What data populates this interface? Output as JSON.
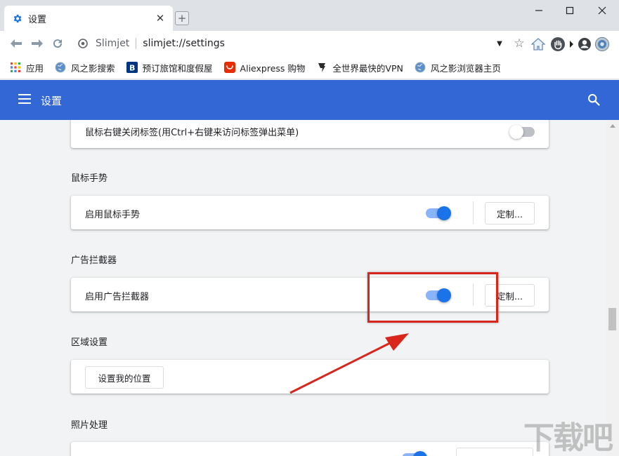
{
  "window": {
    "tab_title": "设置",
    "tab_icon": "gear-icon",
    "controls": [
      "minimize-icon",
      "maximize-icon",
      "close-icon"
    ]
  },
  "toolbar": {
    "site_name": "Slimjet",
    "url": "slimjet://settings"
  },
  "bookmarks": [
    {
      "label": "应用",
      "icon": "apps-grid-icon"
    },
    {
      "label": "风之影搜索",
      "icon": "globe-icon"
    },
    {
      "label": "预订旅馆和度假屋",
      "icon": "booking-icon"
    },
    {
      "label": "Aliexpress 购物",
      "icon": "aliexpress-icon"
    },
    {
      "label": "全世界最快的VPN",
      "icon": "vpn-icon"
    },
    {
      "label": "风之影浏览器主页",
      "icon": "globe-icon"
    }
  ],
  "header": {
    "title": "设置"
  },
  "settings": {
    "close_tab_row": {
      "label": "鼠标右键关闭标签(用Ctrl+右键来访问标签弹出菜单)",
      "enabled": false
    },
    "mouse_gesture": {
      "section": "鼠标手势",
      "label": "启用鼠标手势",
      "enabled": true,
      "button": "定制..."
    },
    "ad_blocker": {
      "section": "广告拦截器",
      "label": "启用广告拦截器",
      "enabled": true,
      "button": "定制..."
    },
    "region": {
      "section": "区域设置",
      "button": "设置我的位置"
    },
    "photo": {
      "section": "照片处理"
    }
  },
  "colors": {
    "header": "#3367d6",
    "toggle_on": "#1a73e8",
    "annotation": "#d9261c"
  },
  "watermark": "下载吧"
}
